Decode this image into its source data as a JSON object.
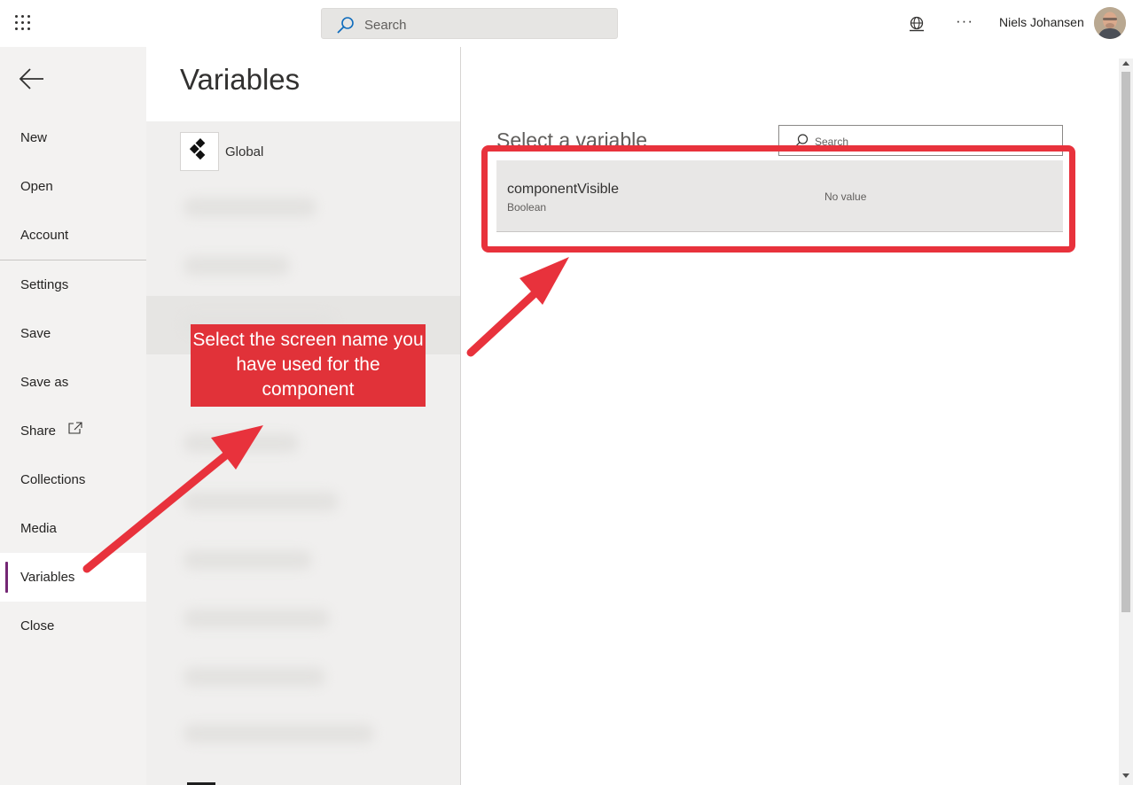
{
  "topbar": {
    "search_placeholder": "Search",
    "user_name": "Niels Johansen",
    "more_label": "···"
  },
  "leftnav": {
    "items": [
      {
        "label": "New"
      },
      {
        "label": "Open"
      },
      {
        "label": "Account"
      },
      {
        "label": "Settings"
      },
      {
        "label": "Save"
      },
      {
        "label": "Save as"
      },
      {
        "label": "Share"
      },
      {
        "label": "Collections"
      },
      {
        "label": "Media"
      },
      {
        "label": "Variables",
        "active": true
      },
      {
        "label": "Close"
      }
    ]
  },
  "midpanel": {
    "title": "Variables",
    "global_label": "Global"
  },
  "rightpanel": {
    "heading": "Select a variable",
    "search_placeholder": "Search",
    "variable": {
      "name": "componentVisible",
      "type": "Boolean",
      "value": "No value"
    }
  },
  "annotation": {
    "callout_text": "Select the screen name you have used for the component",
    "color": "#e13239"
  },
  "colors": {
    "accent": "#742774",
    "annotation_red": "#e8323c"
  }
}
